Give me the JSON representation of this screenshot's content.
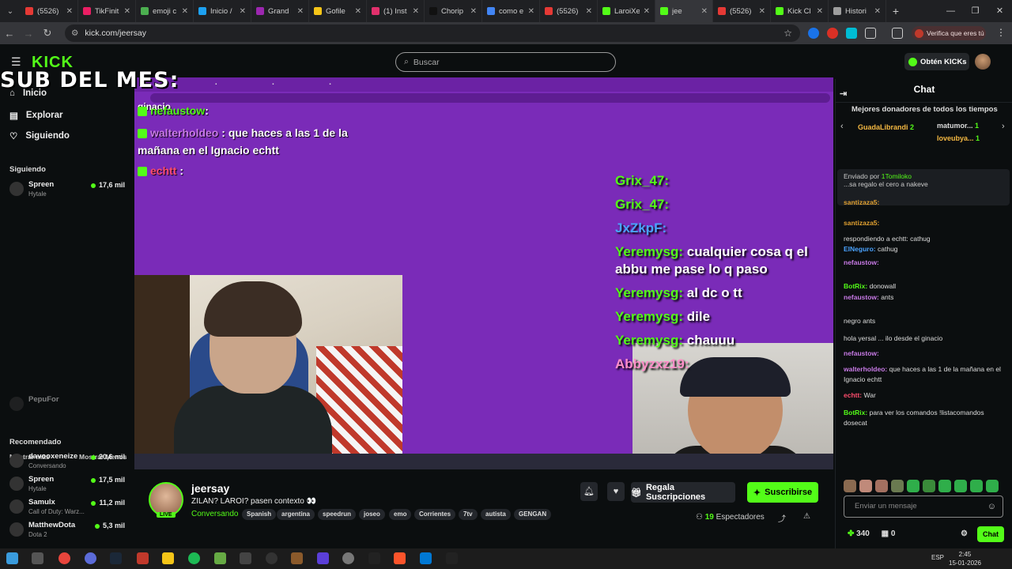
{
  "browser": {
    "tabs": [
      {
        "title": "(5526)",
        "color": "#e53935"
      },
      {
        "title": "TikFinit",
        "color": "#e91e63"
      },
      {
        "title": "emoji c",
        "color": "#4caf50"
      },
      {
        "title": "Inicio /",
        "color": "#1da1f2"
      },
      {
        "title": "Grand",
        "color": "#9c27b0"
      },
      {
        "title": "Gofile",
        "color": "#f5c518"
      },
      {
        "title": "(1) Inst",
        "color": "#e1306c"
      },
      {
        "title": "Chorip",
        "color": "#111111"
      },
      {
        "title": "como e",
        "color": "#4285f4"
      },
      {
        "title": "(5526)",
        "color": "#e53935"
      },
      {
        "title": "LaroiXe",
        "color": "#53fc18"
      },
      {
        "title": "jee",
        "color": "#53fc18",
        "active": true
      },
      {
        "title": "(5526)",
        "color": "#e53935"
      },
      {
        "title": "Kick Cl",
        "color": "#53fc18"
      },
      {
        "title": "Histori",
        "color": "#9e9e9e"
      }
    ],
    "url": "kick.com/jeersay",
    "verify_label": "Verifica que eres tú"
  },
  "header": {
    "search_placeholder": "Buscar",
    "get_kicks": "Obtén KICKs",
    "logo": "KICK"
  },
  "sidebar": {
    "nav": [
      {
        "label": "Inicio",
        "icon": "home-icon"
      },
      {
        "label": "Explorar",
        "icon": "compass-icon"
      },
      {
        "label": "Siguiendo",
        "icon": "heart-icon"
      }
    ],
    "following_title": "Siguiendo",
    "following": [
      {
        "name": "Spreen",
        "category": "Hytale",
        "viewers": "17,6 mil"
      }
    ],
    "faded_channel": "PepuFor",
    "show_more": "Mostrar más",
    "show_less": "Mostrar Menos",
    "recommended_title": "Recomendado",
    "recommended": [
      {
        "name": "davooxeneize",
        "category": "Conversando",
        "viewers": "20,6 mil"
      },
      {
        "name": "Spreen",
        "category": "Hytale",
        "viewers": "17,5 mil"
      },
      {
        "name": "Samulx",
        "category": "Call of Duty: Warz...",
        "viewers": "11,2 mil"
      },
      {
        "name": "MatthewDota",
        "category": "Dota 2",
        "viewers": "5,3 mil"
      }
    ]
  },
  "stream_overlay": {
    "sub_text": "SUB DEL MES:",
    "sub_name": "ginacio",
    "inner_chat": [
      {
        "user": "nefaustow",
        "text": ""
      },
      {
        "user": "walterholdeo",
        "text": "que haces a las 1 de la"
      },
      {
        "user": "",
        "text": "mañana en el Ignacio echtt"
      },
      {
        "user": "echtt",
        "text": ""
      }
    ],
    "big_chat": [
      {
        "user": "Grix_47:",
        "text": ""
      },
      {
        "user": "Grix_47:",
        "text": ""
      },
      {
        "user": "JxZkpF:",
        "text": ""
      },
      {
        "user": "Yeremysg:",
        "text": "cualquier cosa q el abbu me pase lo q paso"
      },
      {
        "user": "Yeremysg:",
        "text": "al dc o tt"
      },
      {
        "user": "Yeremysg:",
        "text": "dile"
      },
      {
        "user": "Yeremysg:",
        "text": "chauuu"
      },
      {
        "user": "Abbyzxz19:",
        "text": ""
      }
    ]
  },
  "streamer": {
    "name": "jeersay",
    "title": "ZILAN? LAROI? pasen contexto 👀",
    "category": "Conversando",
    "live": "LIVE",
    "tags": [
      "Spanish",
      "argentina",
      "speedrun",
      "joseo",
      "emo",
      "Corrientes",
      "7tv",
      "autista",
      "GENGAN"
    ],
    "gift_label": "Regala Suscripciones",
    "subscribe_label": "Suscribirse",
    "viewers": "19",
    "viewers_label": "Espectadores"
  },
  "chat": {
    "title": "Chat",
    "donors_title": "Mejores donadores de todos los tiempos",
    "donors": [
      {
        "name": "GuadaLibrandi",
        "amount": "2"
      },
      {
        "name": "matumor...",
        "amount": "1"
      },
      {
        "name": "loveubya...",
        "amount": "1"
      }
    ],
    "pinned_by_label": "Enviado por",
    "pinned_by": "1Tomiloko",
    "pinned_text": "...sa regalo el cero a nakeve",
    "messages": [
      {
        "user": "santizaza5:",
        "text": "",
        "color": "#e0a030"
      },
      {
        "user": "santizaza5:",
        "text": "",
        "color": "#e0a030"
      },
      {
        "user": "",
        "text": "respondiendo a echtt: cathug",
        "color": "#888888"
      },
      {
        "user": "ElNeguro:",
        "text": "cathug",
        "color": "#4aa3ff"
      },
      {
        "user": "nefaustow:",
        "text": "",
        "color": "#c87ae6"
      },
      {
        "user": "BotRix:",
        "text": "donowall",
        "color": "#53fc18"
      },
      {
        "user": "nefaustow:",
        "text": "ants",
        "color": "#c87ae6"
      },
      {
        "user": "",
        "text": "negro ants",
        "color": "#dddddd"
      },
      {
        "user": "",
        "text": "hola yersal ... ilo desde el ginacio",
        "color": "#dddddd"
      },
      {
        "user": "nefaustow:",
        "text": "",
        "color": "#c87ae6"
      },
      {
        "user": "walterholdeo:",
        "text": "que haces a las 1 de la mañana en el Ignacio echtt",
        "color": "#c87ae6"
      },
      {
        "user": "echtt:",
        "text": "War",
        "color": "#ff4d6d"
      },
      {
        "user": "BotRix:",
        "text": "para ver los comandos !listacomandos dosecat",
        "color": "#53fc18"
      }
    ],
    "input_placeholder": "Enviar un mensaje",
    "kicks_count": "340",
    "gifts_count": "0",
    "chat_button": "Chat"
  },
  "taskbar": {
    "lang": "ESP",
    "time": "2:45",
    "date": "15-01-2026"
  }
}
